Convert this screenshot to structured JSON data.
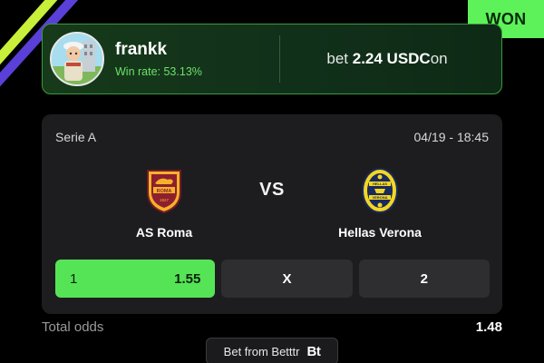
{
  "status_badge": "WON",
  "user": {
    "name": "frankk",
    "win_rate_label": "Win rate: 53.13%"
  },
  "bet": {
    "prefix": "bet",
    "amount": "2.24 USDC",
    "suffix": "on"
  },
  "match": {
    "league": "Serie A",
    "datetime": "04/19 - 18:45",
    "vs_label": "VS",
    "home_team": "AS Roma",
    "away_team": "Hellas Verona",
    "odds": [
      {
        "label": "1",
        "value": "1.55",
        "selected": true
      },
      {
        "label": "X",
        "value": "",
        "selected": false
      },
      {
        "label": "2",
        "value": "",
        "selected": false
      }
    ]
  },
  "total": {
    "label": "Total odds",
    "value": "1.48"
  },
  "source": {
    "label": "Bet from Betttr",
    "logo_text": "Bt"
  },
  "colors": {
    "accent_green": "#55e456",
    "card_bg": "#1d1d1f",
    "user_card_border": "#3a9b3d",
    "stripe_lime": "#c8ef3a",
    "stripe_violet": "#5b3fd9"
  },
  "icons": {
    "home_crest": "as-roma-crest-icon",
    "away_crest": "hellas-verona-crest-icon",
    "source_logo": "betttr-logo-icon"
  }
}
